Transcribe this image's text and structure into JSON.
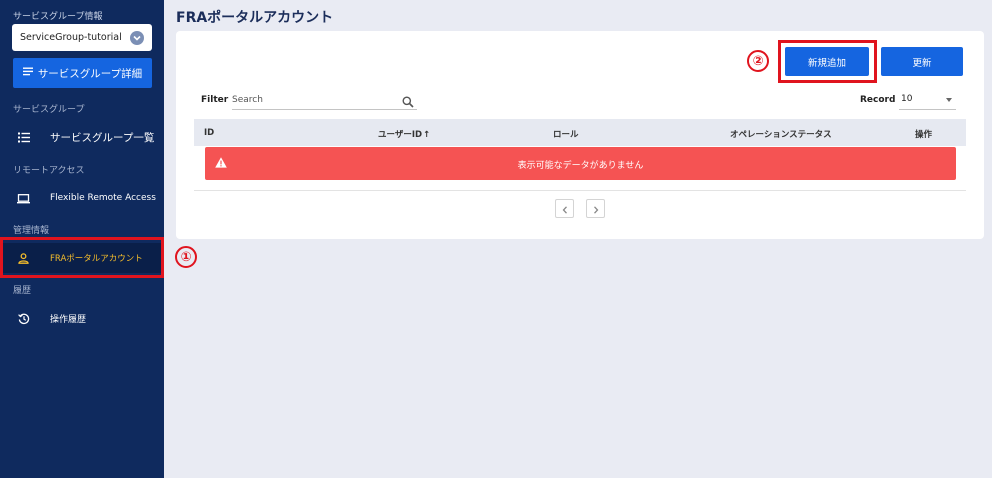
{
  "sidebar": {
    "group_info_label": "サービスグループ情報",
    "selected_group": "ServiceGroup-tutorial",
    "detail_button": "サービスグループ詳細",
    "sections": {
      "group": "サービスグループ",
      "remote": "リモートアクセス",
      "admin": "管理情報",
      "history": "履歴"
    },
    "items": {
      "group_list": "サービスグループ一覧",
      "fra": "Flexible Remote Access",
      "portal_account": "FRAポータルアカウント",
      "op_history": "操作履歴"
    }
  },
  "main": {
    "title": "FRAポータルアカウント",
    "add_button": "新規追加",
    "refresh_button": "更新",
    "filter_label": "Filter",
    "search_placeholder": "Search",
    "record_label": "Record",
    "record_value": "10",
    "columns": [
      "ID",
      "ユーザーID",
      "ロール",
      "オペレーションステータス",
      "操作"
    ],
    "empty_message": "表示可能なデータがありません"
  },
  "annotations": {
    "one": "①",
    "two": "②"
  },
  "colors": {
    "sidebar_bg": "#0f2a5e",
    "accent": "#1565e0",
    "active_text": "#f5bd2b",
    "warning": "#f55353",
    "highlight": "#e0141e"
  }
}
